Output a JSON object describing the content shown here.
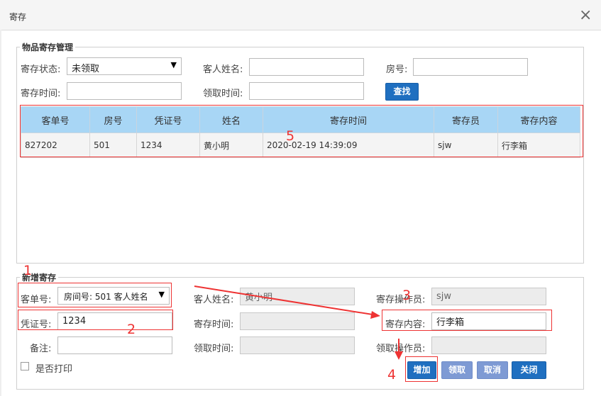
{
  "dialog": {
    "title": "寄存",
    "close_glyph": "×"
  },
  "search": {
    "legend": "物品寄存管理",
    "status_label": "寄存状态:",
    "status_value": "未领取",
    "guest_name_label": "客人姓名:",
    "guest_name_value": "",
    "room_label": "房号:",
    "room_value": "",
    "deposit_time_label": "寄存时间:",
    "deposit_time_value": "",
    "pickup_time_label": "领取时间:",
    "pickup_time_value": "",
    "search_button": "查找"
  },
  "table": {
    "columns": [
      "客单号",
      "房号",
      "凭证号",
      "姓名",
      "寄存时间",
      "寄存员",
      "寄存内容"
    ],
    "rows": [
      [
        "827202",
        "501",
        "1234",
        "黄小明",
        "2020-02-19 14:39:09",
        "sjw",
        "行李箱"
      ]
    ]
  },
  "form": {
    "legend": "新增寄存",
    "order_label": "客单号:",
    "order_value": "房间号: 501 客人姓名",
    "guest_name_label": "客人姓名:",
    "guest_name_value": "黄小明",
    "operator_label": "寄存操作员:",
    "operator_value": "sjw",
    "voucher_label": "凭证号:",
    "voucher_value": "1234",
    "deposit_time_label": "寄存时间:",
    "deposit_time_value": "",
    "content_label": "寄存内容:",
    "content_value": "行李箱",
    "remark_label": "备注:",
    "remark_value": "",
    "pickup_time_label": "领取时间:",
    "pickup_time_value": "",
    "pickup_operator_label": "领取操作员:",
    "pickup_operator_value": "",
    "print_label": "是否打印"
  },
  "buttons": {
    "add": "增加",
    "pickup": "领取",
    "cancel": "取消",
    "close": "关闭"
  },
  "annotations": {
    "n1": "1",
    "n2": "2",
    "n3": "3",
    "n4": "4",
    "n5": "5"
  },
  "colors": {
    "header_bg": "#a8d6f5",
    "button_blue": "#1f6fc0",
    "button_light": "#7e9ad4",
    "annotation_red": "#ee3333"
  }
}
